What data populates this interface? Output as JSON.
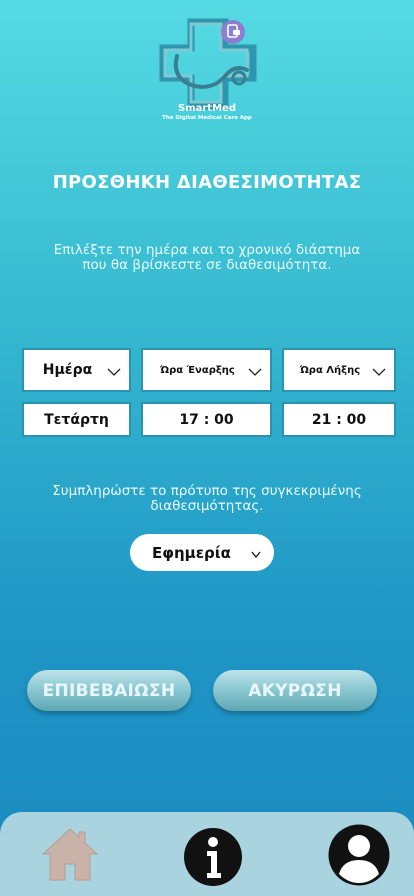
{
  "app": {
    "name": "SmartMed",
    "tagline": "The Digital Medical Care App"
  },
  "page": {
    "title": "ΠΡΟΣΘΗΚΗ ΔΙΑΘΕΣΙΜΟΤΗΤΑΣ",
    "instruction_time": "Επιλέξτε την ημέρα και το χρονικό διάστημα που θα βρίσκεστε σε διαθεσιμότητα.",
    "instruction_template": "Συμπληρώστε το πρότυπο της συγκεκριμένης διαθεσιμότητας."
  },
  "selectors": {
    "day": {
      "header": "Ημέρα",
      "value": "Τετάρτη"
    },
    "start": {
      "header": "Ώρα Έναρξης",
      "value": "17 : 00"
    },
    "end": {
      "header": "Ώρα Λήξης",
      "value": "21 : 00"
    }
  },
  "template_select": {
    "value": "Εφημερία"
  },
  "buttons": {
    "confirm": "ΕΠΙΒΕΒΑΙΩΣΗ",
    "cancel": "ΑΚΥΡΩΣΗ"
  },
  "nav": {
    "items": [
      {
        "icon": "home-icon"
      },
      {
        "icon": "info-icon"
      },
      {
        "icon": "user-icon"
      }
    ]
  },
  "colors": {
    "bg_top": "#55dbe3",
    "bg_bottom": "#1a89bf",
    "navbar": "#a9d3df",
    "box_border": "#2c92ad"
  }
}
